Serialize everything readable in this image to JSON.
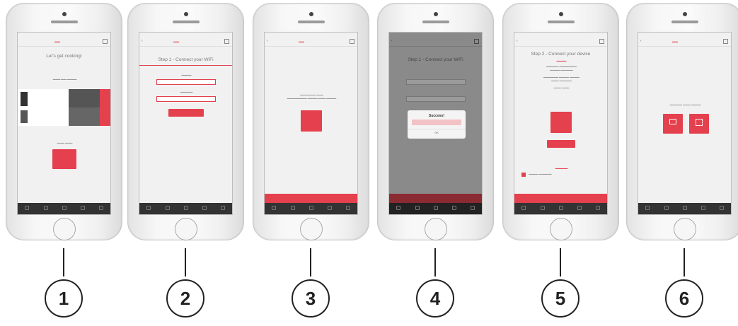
{
  "steps": [
    {
      "label": "1"
    },
    {
      "label": "2"
    },
    {
      "label": "3"
    },
    {
      "label": "4"
    },
    {
      "label": "5"
    },
    {
      "label": "6"
    }
  ],
  "screen1": {
    "title": "Let's get cooking!"
  },
  "screen2": {
    "title": "Step 1 - Connect your WiFi"
  },
  "screen4": {
    "dialog_title": "Success!",
    "dialog_ok": "OK"
  },
  "screen5": {
    "title": "Step 2 - Connect your device"
  },
  "colors": {
    "accent": "#e5404e",
    "tabbar": "#333333",
    "outline": "#222222"
  }
}
